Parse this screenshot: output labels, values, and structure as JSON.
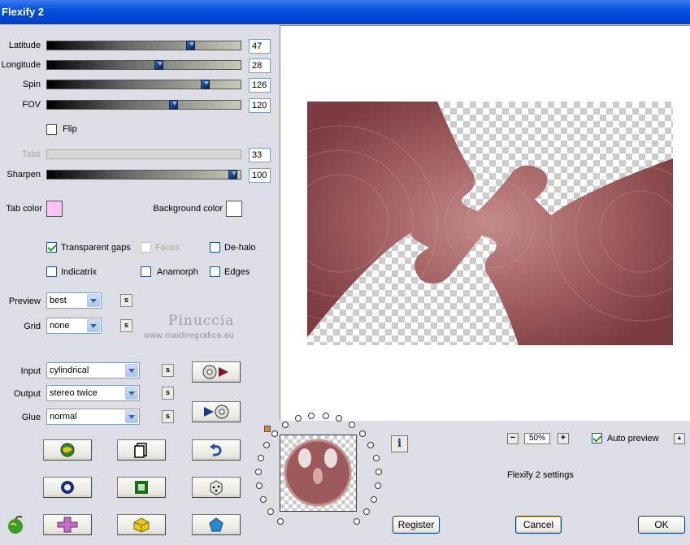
{
  "window": {
    "title": "Flexify 2"
  },
  "sliders": [
    {
      "label": "Latitude",
      "value": "47",
      "fraction": 0.75,
      "enabled": true
    },
    {
      "label": "Longitude",
      "value": "28",
      "fraction": 0.58,
      "enabled": true
    },
    {
      "label": "Spin",
      "value": "126",
      "fraction": 0.83,
      "enabled": true
    },
    {
      "label": "FOV",
      "value": "120",
      "fraction": 0.66,
      "enabled": true
    },
    {
      "label": "Tabs",
      "value": "33",
      "fraction": 0,
      "enabled": false
    },
    {
      "label": "Sharpen",
      "value": "100",
      "fraction": 0.98,
      "enabled": true
    }
  ],
  "flip": {
    "label": "Flip",
    "checked": false
  },
  "colors": {
    "tab_label": "Tab color",
    "tab_value": "#fbc2f5",
    "bg_label": "Background color",
    "bg_value": "#ffffff",
    "accent": "#9c5a5c"
  },
  "options": {
    "transparent_gaps": {
      "label": "Transparent gaps",
      "checked": true
    },
    "faces": {
      "label": "Faces",
      "checked": false,
      "enabled": false
    },
    "dehalo": {
      "label": "De-halo",
      "checked": false
    },
    "indicatrix": {
      "label": "Indicatrix",
      "checked": false
    },
    "anamorph": {
      "label": "Anamorph",
      "checked": false
    },
    "edges": {
      "label": "Edges",
      "checked": false
    }
  },
  "preview": {
    "label": "Preview",
    "value": "best"
  },
  "grid": {
    "label": "Grid",
    "value": "none"
  },
  "watermark": {
    "line1": "Pinuccia",
    "line2": "www.maidiregrafica.eu"
  },
  "input": {
    "label": "Input",
    "value": "cylindrical"
  },
  "output": {
    "label": "Output",
    "value": "stereo twice"
  },
  "glue": {
    "label": "Glue",
    "value": "normal"
  },
  "s_label": "s",
  "icons": [
    "forward-convert-icon",
    "backward-convert-icon",
    "globe-icon",
    "copy-page-icon",
    "undo-icon",
    "ring-icon",
    "square-icon",
    "dice-icon",
    "cross-icon",
    "cube-icon",
    "pentagon-icon",
    "apple-logo-icon",
    "info-icon"
  ],
  "zoom": {
    "minus": "−",
    "value": "50%",
    "plus": "+"
  },
  "auto_preview": {
    "label": "Auto preview",
    "checked": true
  },
  "up_button": "▲",
  "settings_text": "Flexify 2 settings",
  "buttons": {
    "register": "Register",
    "cancel": "Cancel",
    "ok": "OK"
  },
  "info": "i"
}
